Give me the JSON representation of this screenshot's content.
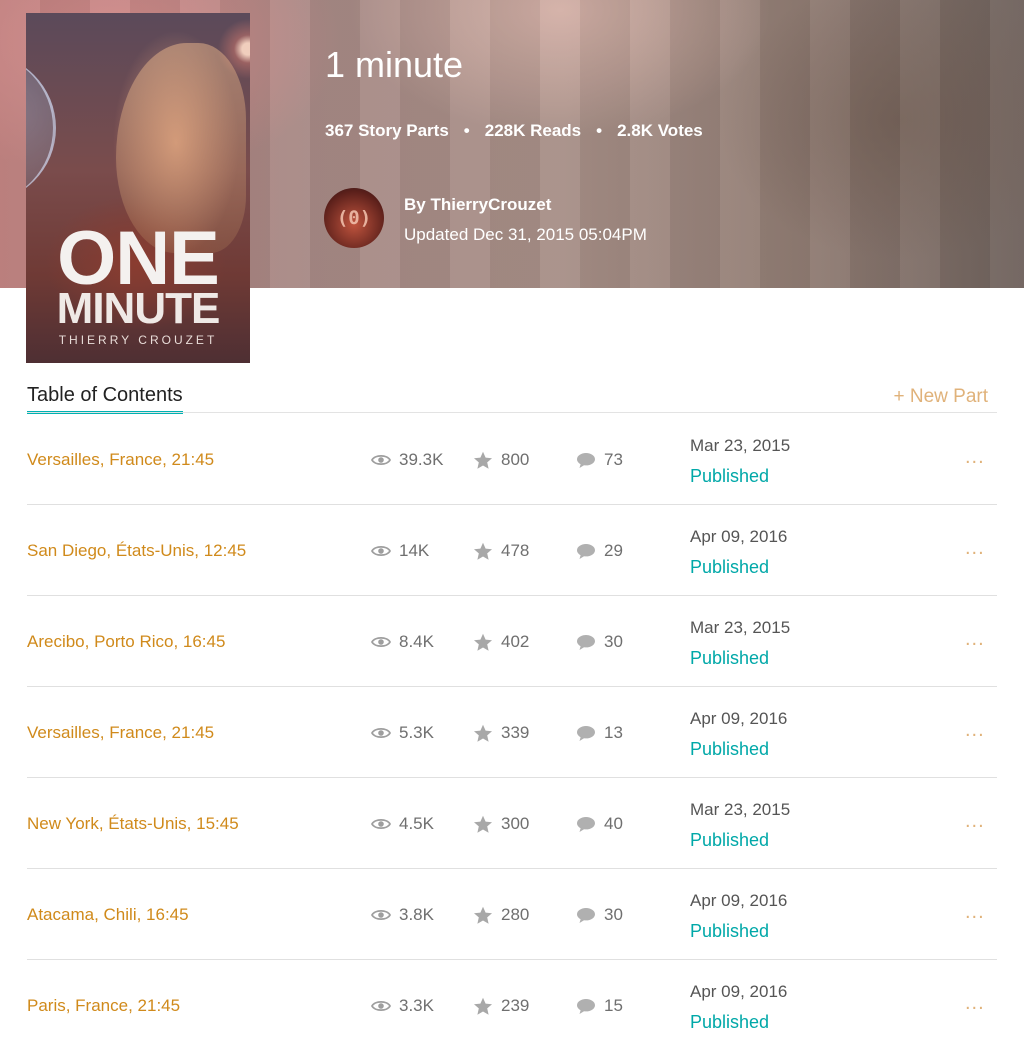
{
  "story": {
    "title": "1 minute",
    "parts": "367 Story Parts",
    "reads": "228K Reads",
    "votes": "2.8K Votes",
    "dot": "•",
    "author": "By ThierryCrouzet",
    "updated": "Updated Dec 31, 2015 05:04PM",
    "avatar_text": "(0)"
  },
  "cover": {
    "line1": "ONE",
    "line2": "MINUTE",
    "line3": "THIERRY CROUZET"
  },
  "toc": {
    "tab_label": "Table of Contents",
    "new_part_label": "+ New Part",
    "more_label": "...",
    "icons": [
      "eye-icon",
      "star-icon",
      "comment-icon"
    ],
    "rows": [
      {
        "name": "Versailles, France, 21:45",
        "reads": "39.3K",
        "votes": "800",
        "comments": "73",
        "date": "Mar 23, 2015",
        "status": "Published"
      },
      {
        "name": "San Diego, États-Unis, 12:45",
        "reads": "14K",
        "votes": "478",
        "comments": "29",
        "date": "Apr 09, 2016",
        "status": "Published"
      },
      {
        "name": "Arecibo, Porto Rico, 16:45",
        "reads": "8.4K",
        "votes": "402",
        "comments": "30",
        "date": "Mar 23, 2015",
        "status": "Published"
      },
      {
        "name": "Versailles, France, 21:45",
        "reads": "5.3K",
        "votes": "339",
        "comments": "13",
        "date": "Apr 09, 2016",
        "status": "Published"
      },
      {
        "name": "New York, États-Unis, 15:45",
        "reads": "4.5K",
        "votes": "300",
        "comments": "40",
        "date": "Mar 23, 2015",
        "status": "Published"
      },
      {
        "name": "Atacama, Chili, 16:45",
        "reads": "3.8K",
        "votes": "280",
        "comments": "30",
        "date": "Apr 09, 2016",
        "status": "Published"
      },
      {
        "name": "Paris, France, 21:45",
        "reads": "3.3K",
        "votes": "239",
        "comments": "15",
        "date": "Apr 09, 2016",
        "status": "Published"
      }
    ]
  },
  "colors": {
    "accent_teal": "#00b2b2",
    "part_name": "#d08a1b",
    "new_part": "#e0b27a"
  }
}
